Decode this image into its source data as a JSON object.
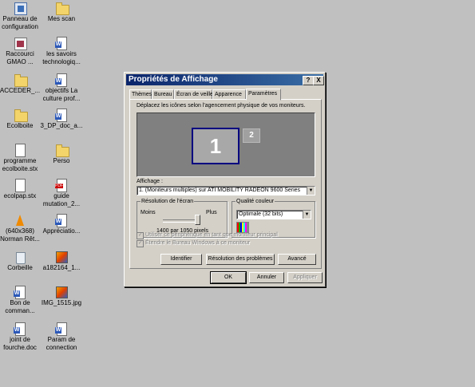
{
  "desktop": {
    "icons": [
      {
        "label": [
          "Panneau de",
          "configuration"
        ],
        "icon": "control-panel-icon"
      },
      {
        "label": [
          "Mes scan"
        ],
        "icon": "folder-icon"
      },
      {
        "label": [
          "Raccourci",
          "GMAO ..."
        ],
        "icon": "shortcut-icon"
      },
      {
        "label": [
          "les savoirs",
          "technologiq..."
        ],
        "icon": "word-document-icon"
      },
      {
        "label": [
          "ACCEDER_..."
        ],
        "icon": "folder-icon"
      },
      {
        "label": [
          "objectifs La",
          "culture prof..."
        ],
        "icon": "word-document-icon"
      },
      {
        "label": [
          "Ecolboite"
        ],
        "icon": "folder-icon"
      },
      {
        "label": [
          "3_DP_doc_a..."
        ],
        "icon": "word-document-icon"
      },
      {
        "label": [
          "programme",
          "ecolboite.stx"
        ],
        "icon": "document-icon"
      },
      {
        "label": [
          "Perso"
        ],
        "icon": "folder-icon"
      },
      {
        "label": [
          "ecolpap.stx"
        ],
        "icon": "document-icon"
      },
      {
        "label": [
          "guide",
          "mutation_2..."
        ],
        "icon": "pdf-document-icon"
      },
      {
        "label": [
          "(640x368)",
          "Norman Rêt..."
        ],
        "icon": "vlc-media-icon"
      },
      {
        "label": [
          "Appréciatio..."
        ],
        "icon": "word-document-icon"
      },
      {
        "label": [
          "Corbeille"
        ],
        "icon": "recycle-bin-icon"
      },
      {
        "label": [
          "a182164_1..."
        ],
        "icon": "image-file-icon"
      },
      {
        "label": [
          "Bon de",
          "comman..."
        ],
        "icon": "word-document-icon"
      },
      {
        "label": [
          "IMG_1515.jpg"
        ],
        "icon": "image-file-icon"
      },
      {
        "label": [
          "joint de",
          "fourche.doc"
        ],
        "icon": "word-document-icon"
      },
      {
        "label": [
          "Param de",
          "connection"
        ],
        "icon": "word-document-icon"
      }
    ]
  },
  "dialog": {
    "title": "Propriétés de Affichage",
    "help_button": "?",
    "close_button": "X",
    "tabs": [
      "Thèmes",
      "Bureau",
      "Écran de veille",
      "Apparence",
      "Paramètres"
    ],
    "active_tab": "Paramètres",
    "hint": "Déplacez les icônes selon l'agencement physique de vos moniteurs.",
    "monitors": [
      "1",
      "2"
    ],
    "display_label": "Affichage :",
    "display_value": "1. (Moniteurs multiples) sur ATI MOBILITY RADEON 9600 Series",
    "resolution": {
      "group_title": "Résolution de l'écran",
      "less": "Moins",
      "more": "Plus",
      "value": "1400 par 1050 pixels",
      "slider_fraction": 1.0
    },
    "color_quality": {
      "group_title": "Qualité couleur",
      "value": "Optimale (32 bits)"
    },
    "checkbox_primary": "Utiliser ce périphérique en tant que moniteur principal",
    "checkbox_extend": "Étendre le Bureau Windows à ce moniteur",
    "buttons": {
      "identify": "Identifier",
      "troubleshoot": "Résolution des problèmes",
      "advanced": "Avancé",
      "ok": "OK",
      "cancel": "Annuler",
      "apply": "Appliquer"
    }
  },
  "colors": {
    "desktop": "#c0c0c0",
    "titlebar": "#0a246a",
    "face": "#d4d0c8"
  }
}
